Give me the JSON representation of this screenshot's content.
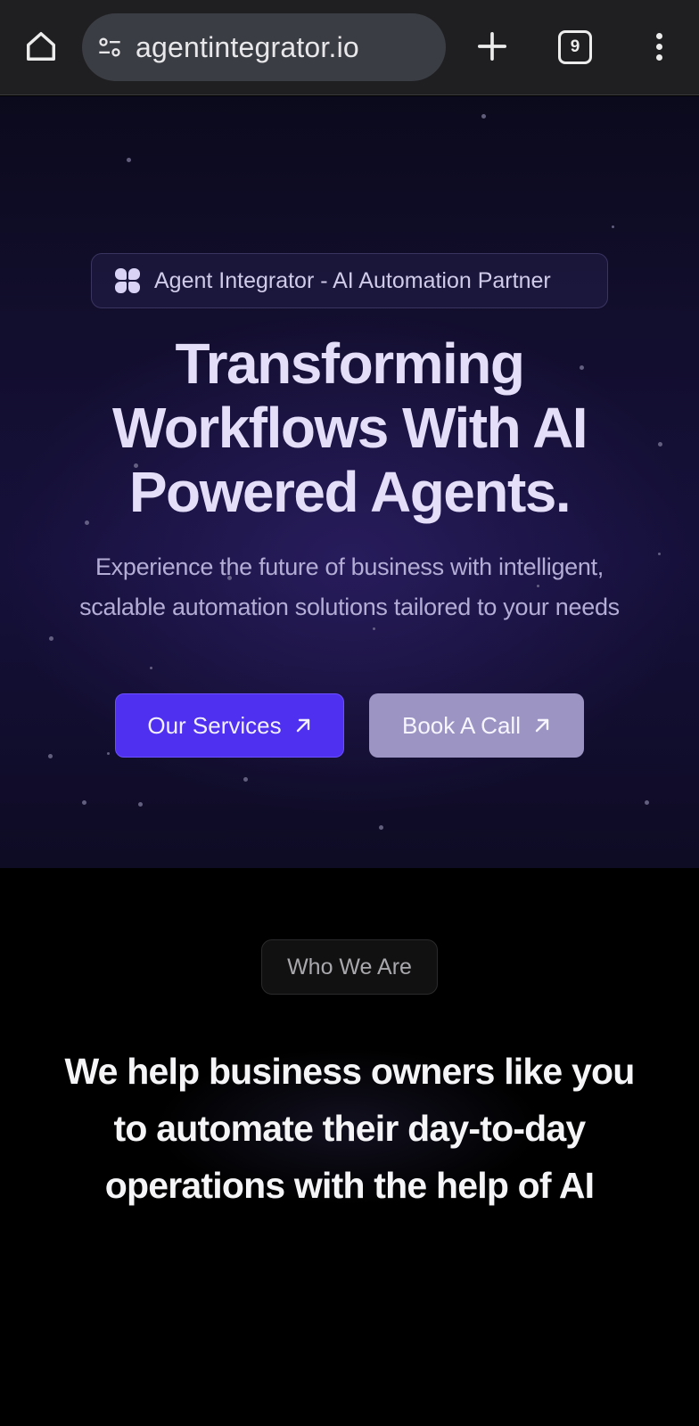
{
  "browser": {
    "url": "agentintegrator.io",
    "tab_count": "9"
  },
  "hero": {
    "badge": "Agent Integrator - AI Automation Partner",
    "title_lines": [
      "Transforming",
      "Workflows With AI",
      "Powered Agents."
    ],
    "subtitle_lines": [
      "Experience the future of business with intelligent,",
      "scalable automation solutions tailored to your needs"
    ],
    "primary_button": "Our Services",
    "secondary_button": "Book A Call"
  },
  "about": {
    "badge": "Who We Are",
    "title_lines": [
      "We help business owners like you",
      "to automate their day-to-day",
      "operations with the help of AI"
    ]
  },
  "icons": {
    "home": "home-icon",
    "site_settings": "site-settings-icon",
    "new_tab": "plus-icon",
    "menu": "more-vert-icon",
    "badge": "four-petal-logo-icon",
    "arrow": "arrow-up-right-icon"
  },
  "colors": {
    "browser_bar": "#1f1f21",
    "hero_bg": "#15103a",
    "primary_button": "#4f2ff0",
    "secondary_button": "#9c95c4",
    "title": "#e4def9"
  }
}
